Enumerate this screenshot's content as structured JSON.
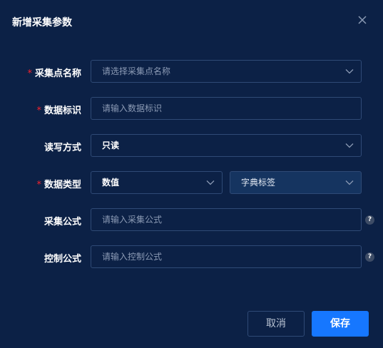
{
  "dialog": {
    "title": "新增采集参数",
    "close_icon": "close-icon"
  },
  "form": {
    "required_mark": "*",
    "collect_point": {
      "label": "采集点名称",
      "placeholder": "请选择采集点名称"
    },
    "data_id": {
      "label": "数据标识",
      "placeholder": "请输入数据标识"
    },
    "rw_mode": {
      "label": "读写方式",
      "value": "只读"
    },
    "data_type": {
      "label": "数据类型",
      "value": "数值",
      "dict_placeholder": "字典标签"
    },
    "collect_formula": {
      "label": "采集公式",
      "placeholder": "请输入采集公式"
    },
    "control_formula": {
      "label": "控制公式",
      "placeholder": "请输入控制公式"
    },
    "help_glyph": "?"
  },
  "footer": {
    "cancel_label": "取消",
    "save_label": "保存"
  },
  "colors": {
    "background": "#0c2146",
    "primary": "#1677ff",
    "required": "#f5222d",
    "border": "#2f4a76"
  }
}
